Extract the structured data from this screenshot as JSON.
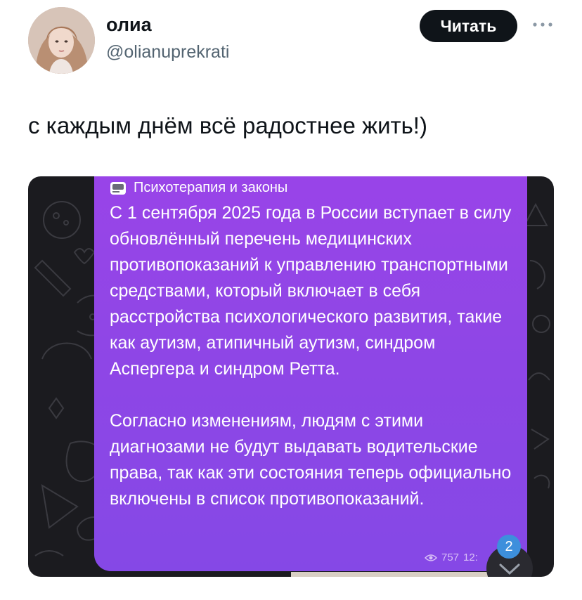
{
  "author": {
    "name": "олиа",
    "handle": "@olianuprekrati"
  },
  "follow_button": {
    "label": "Читать"
  },
  "tweet": {
    "text": "с каждым днём всё радостнее жить!)"
  },
  "embedded_screenshot": {
    "channel_name": "Психотерапия и законы",
    "message_paragraphs": [
      "С 1 сентября 2025 года в России вступает в силу обновлённый перечень медицинских противопоказаний к управлению транспортными средствами, который включает в себя расстройства психологического развития, такие как аутизм, атипичный аутизм, синдром Аспергера и синдром Ретта.",
      "Согласно изменениям, людям с этими диагнозами не будут выдавать водительские права, так как эти состояния теперь официально включены в список противопоказаний."
    ],
    "views": "757",
    "time_partial": "12:",
    "unread_badge": "2",
    "bubble_color": "#9244e6"
  }
}
